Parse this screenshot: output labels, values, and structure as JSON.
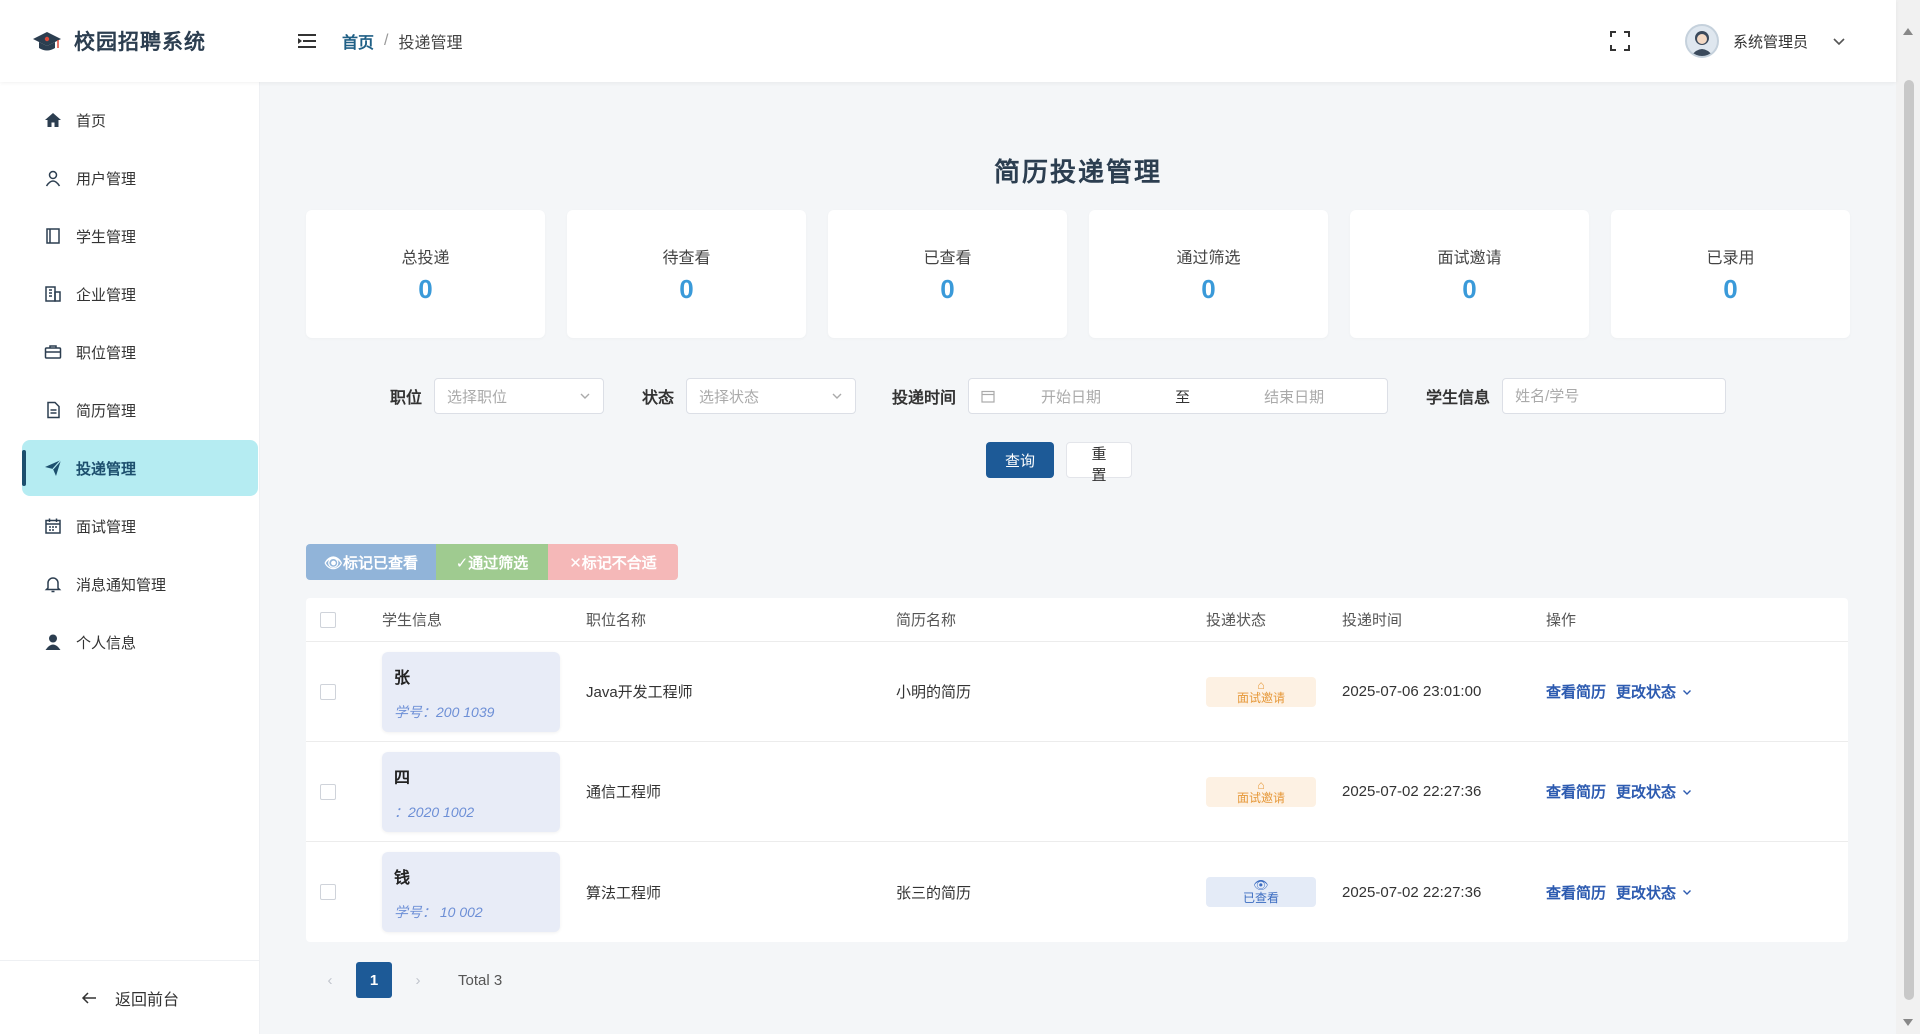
{
  "app": {
    "title": "校园招聘系统"
  },
  "breadcrumb": {
    "home": "首页",
    "separator": "/",
    "current": "投递管理"
  },
  "user": {
    "name": "系统管理员"
  },
  "sidebar": {
    "items": [
      {
        "label": "首页",
        "icon": "home-icon"
      },
      {
        "label": "用户管理",
        "icon": "user-icon"
      },
      {
        "label": "学生管理",
        "icon": "book-icon"
      },
      {
        "label": "企业管理",
        "icon": "building-icon"
      },
      {
        "label": "职位管理",
        "icon": "briefcase-icon"
      },
      {
        "label": "简历管理",
        "icon": "document-icon"
      },
      {
        "label": "投递管理",
        "icon": "send-icon",
        "active": true
      },
      {
        "label": "面试管理",
        "icon": "calendar-icon"
      },
      {
        "label": "消息通知管理",
        "icon": "bell-icon"
      },
      {
        "label": "个人信息",
        "icon": "person-icon"
      }
    ],
    "back": "返回前台"
  },
  "page": {
    "title": "简历投递管理"
  },
  "stats": [
    {
      "label": "总投递",
      "value": "0"
    },
    {
      "label": "待查看",
      "value": "0"
    },
    {
      "label": "已查看",
      "value": "0"
    },
    {
      "label": "通过筛选",
      "value": "0"
    },
    {
      "label": "面试邀请",
      "value": "0"
    },
    {
      "label": "已录用",
      "value": "0"
    }
  ],
  "filters": {
    "position_label": "职位",
    "position_placeholder": "选择职位",
    "status_label": "状态",
    "status_placeholder": "选择状态",
    "time_label": "投递时间",
    "start_placeholder": "开始日期",
    "range_sep": "至",
    "end_placeholder": "结束日期",
    "student_label": "学生信息",
    "student_placeholder": "姓名/学号",
    "query": "查询",
    "reset": "重置"
  },
  "bulk": {
    "mark_viewed": "👁标记已查看",
    "pass": "✓通过筛选",
    "reject": "✕标记不合适"
  },
  "table": {
    "headers": [
      "学生信息",
      "职位名称",
      "简历名称",
      "投递状态",
      "投递时间",
      "操作"
    ],
    "rows": [
      {
        "name": "张",
        "sid": "学号：200 1039",
        "job": "Java开发工程师",
        "resume": "小明的简历",
        "status": "面试邀请",
        "status_type": "interview",
        "status_icon": "⌂",
        "time": "2025-07-06 23:01:00",
        "view": "查看简历",
        "change": "更改状态"
      },
      {
        "name": "四",
        "sid": "：2020 1002",
        "job": "通信工程师",
        "resume": "",
        "status": "面试邀请",
        "status_type": "interview",
        "status_icon": "⌂",
        "time": "2025-07-02 22:27:36",
        "view": "查看简历",
        "change": "更改状态"
      },
      {
        "name": "钱",
        "sid": "学号： 10 002",
        "job": "算法工程师",
        "resume": "张三的简历",
        "status": "已查看",
        "status_type": "viewed",
        "status_icon": "👁",
        "time": "2025-07-02 22:27:36",
        "view": "查看简历",
        "change": "更改状态"
      }
    ]
  },
  "pagination": {
    "current": "1",
    "total": "Total 3"
  },
  "colors": {
    "primary": "#1d5a97",
    "accent": "#3a9ad9",
    "active_bg": "#b5ecf2"
  }
}
